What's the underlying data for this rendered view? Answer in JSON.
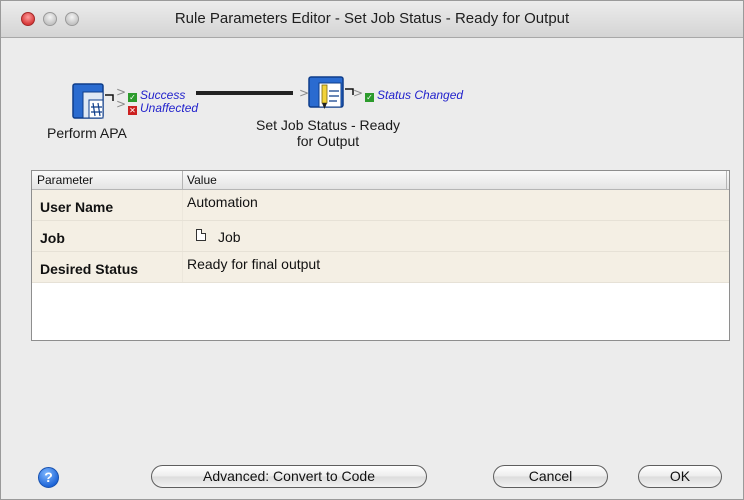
{
  "window": {
    "title": "Rule Parameters Editor - Set Job Status  - Ready for Output"
  },
  "diagram": {
    "source_node": {
      "label": "Perform APA",
      "icon": "perform-apa-icon",
      "outputs": [
        {
          "label": "Success",
          "state": "check"
        },
        {
          "label": "Unaffected",
          "state": "cross"
        }
      ]
    },
    "target_node": {
      "label_line1": "Set Job Status  - Ready",
      "label_line2": "for Output",
      "icon": "set-job-status-icon",
      "outputs": [
        {
          "label": "Status Changed",
          "state": "check"
        }
      ]
    },
    "colors": {
      "status_text": "#2222cc",
      "check": "#2c9b2c",
      "cross": "#cc2020"
    }
  },
  "table": {
    "columns": [
      "Parameter",
      "Value"
    ],
    "rows": [
      {
        "parameter": "User Name",
        "value": "Automation"
      },
      {
        "parameter": "Job",
        "value": "Job",
        "icon": "document-icon"
      },
      {
        "parameter": "Desired Status",
        "value": "Ready for final output"
      }
    ]
  },
  "buttons": {
    "help": "?",
    "advanced": "Advanced: Convert to Code",
    "cancel": "Cancel",
    "ok": "OK"
  }
}
